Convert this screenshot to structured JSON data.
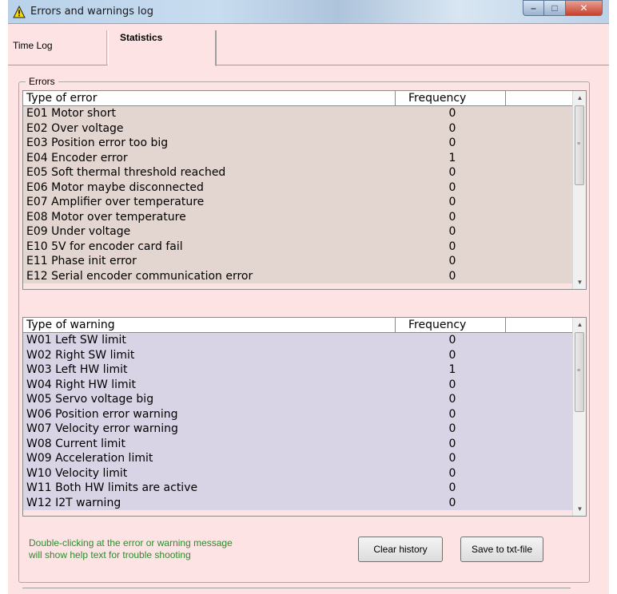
{
  "window": {
    "title": "Errors and warnings log",
    "controls": {
      "minimize": "–",
      "maximize": "□",
      "close": "✕"
    }
  },
  "tabs": [
    {
      "label": "Time Log",
      "selected": false
    },
    {
      "label": "Statistics",
      "selected": true
    }
  ],
  "errors_group": {
    "label": "Errors",
    "headers": {
      "type": "Type of error",
      "frequency": "Frequency"
    },
    "rows": [
      {
        "name": "E01 Motor short",
        "frequency": "0"
      },
      {
        "name": "E02 Over voltage",
        "frequency": "0"
      },
      {
        "name": "E03 Position error too big",
        "frequency": "0"
      },
      {
        "name": "E04 Encoder error",
        "frequency": "1"
      },
      {
        "name": "E05 Soft thermal threshold reached",
        "frequency": "0"
      },
      {
        "name": "E06 Motor maybe disconnected",
        "frequency": "0"
      },
      {
        "name": "E07 Amplifier over temperature",
        "frequency": "0"
      },
      {
        "name": "E08 Motor over temperature",
        "frequency": "0"
      },
      {
        "name": "E09 Under voltage",
        "frequency": "0"
      },
      {
        "name": "E10 5V for encoder card fail",
        "frequency": "0"
      },
      {
        "name": "E11 Phase init error",
        "frequency": "0"
      },
      {
        "name": "E12 Serial encoder communication error",
        "frequency": "0"
      }
    ]
  },
  "warnings_table": {
    "headers": {
      "type": "Type of warning",
      "frequency": "Frequency"
    },
    "rows": [
      {
        "name": "W01 Left SW limit",
        "frequency": "0"
      },
      {
        "name": "W02 Right SW limit",
        "frequency": "0"
      },
      {
        "name": "W03 Left HW limit",
        "frequency": "1"
      },
      {
        "name": "W04 Right HW limit",
        "frequency": "0"
      },
      {
        "name": "W05 Servo voltage big",
        "frequency": "0"
      },
      {
        "name": "W06 Position error warning",
        "frequency": "0"
      },
      {
        "name": "W07 Velocity error warning",
        "frequency": "0"
      },
      {
        "name": "W08 Current limit",
        "frequency": "0"
      },
      {
        "name": "W09 Acceleration limit",
        "frequency": "0"
      },
      {
        "name": "W10 Velocity limit",
        "frequency": "0"
      },
      {
        "name": "W11 Both HW limits are active",
        "frequency": "0"
      },
      {
        "name": "W12 I2T warning",
        "frequency": "0"
      }
    ]
  },
  "hint": {
    "line1": "Double-clicking at the error or warning message",
    "line2": "will show help text for trouble shooting"
  },
  "buttons": {
    "clear": "Clear history",
    "save": "Save to txt-file"
  },
  "colors": {
    "window_bg": "#fde3e3",
    "error_rows_bg": "#e3d5cf",
    "warning_rows_bg": "#d9d3e6",
    "hint_text": "#2e8b2e"
  }
}
